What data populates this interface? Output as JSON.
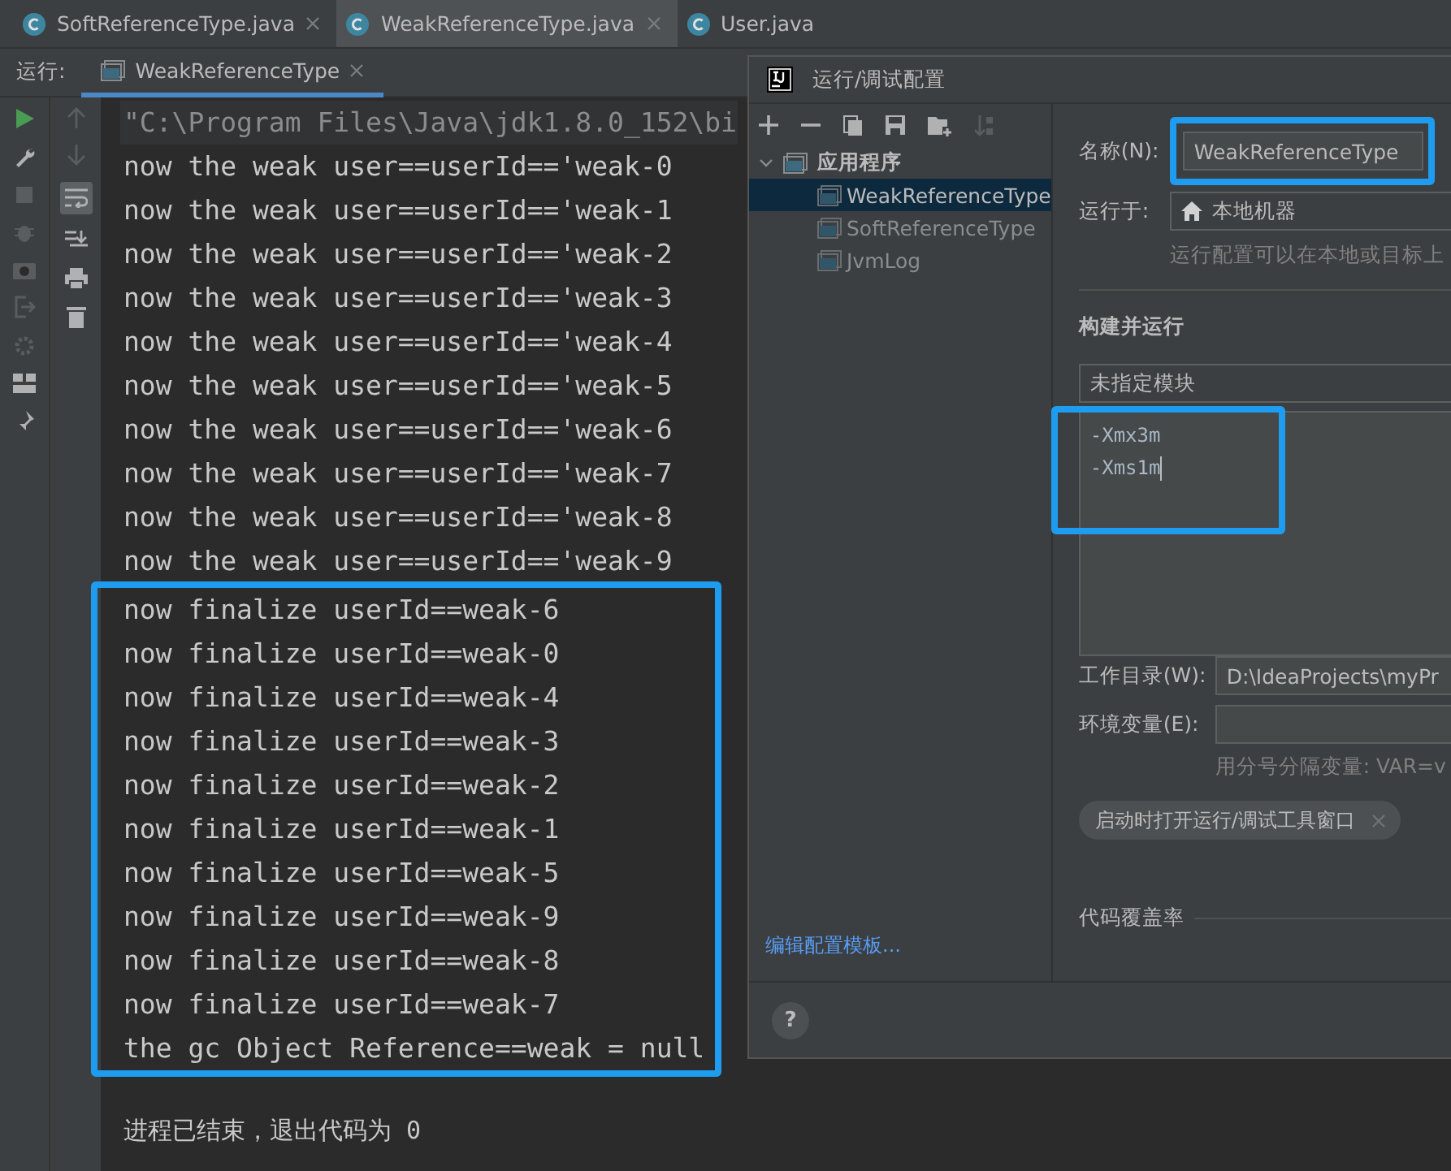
{
  "editor_tabs": [
    {
      "label": "SoftReferenceType.java",
      "selected": false
    },
    {
      "label": "WeakReferenceType.java",
      "selected": true
    },
    {
      "label": "User.java",
      "selected": false
    }
  ],
  "run_panel": {
    "label": "运行:",
    "tab": "WeakReferenceType"
  },
  "console_toolbar": {
    "soft_wrap": true
  },
  "console": {
    "command": "\"C:\\Program Files\\Java\\jdk1.8.0_152\\bi",
    "groups": [
      {
        "highlighted": false,
        "lines": [
          "now the weak user==userId=='weak-0",
          "now the weak user==userId=='weak-1",
          "now the weak user==userId=='weak-2",
          "now the weak user==userId=='weak-3",
          "now the weak user==userId=='weak-4",
          "now the weak user==userId=='weak-5",
          "now the weak user==userId=='weak-6",
          "now the weak user==userId=='weak-7",
          "now the weak user==userId=='weak-8",
          "now the weak user==userId=='weak-9"
        ]
      },
      {
        "highlighted": true,
        "lines": [
          "now finalize userId==weak-6",
          "now finalize userId==weak-0",
          "now finalize userId==weak-4",
          "now finalize userId==weak-3",
          "now finalize userId==weak-2",
          "now finalize userId==weak-1",
          "now finalize userId==weak-5",
          "now finalize userId==weak-9",
          "now finalize userId==weak-8",
          "now finalize userId==weak-7",
          "the gc Object Reference==weak = null"
        ]
      }
    ],
    "exit_message": "进程已结束，退出代码为 0"
  },
  "dialog": {
    "title": "运行/调试配置",
    "tree": [
      {
        "label": "应用程序",
        "expanded": true,
        "children": [
          {
            "label": "WeakReferenceType",
            "selected": true
          },
          {
            "label": "SoftReferenceType",
            "selected": false
          },
          {
            "label": "JvmLog",
            "selected": false
          }
        ]
      }
    ],
    "templates_link": "编辑配置模板...",
    "form": {
      "name_label": "名称(N):",
      "name_value": "WeakReferenceType",
      "name_highlighted": true,
      "run_on_label": "运行于:",
      "run_on_value": "本地机器",
      "run_on_hint": "运行配置可以在本地或目标上",
      "build_heading": "构建并运行",
      "module": "未指定模块",
      "vm_options": [
        "-Xmx3m",
        "-Xms1m"
      ],
      "vm_highlighted": true,
      "workdir_label": "工作目录(W):",
      "workdir_value": "D:\\IdeaProjects\\myPr",
      "env_label": "环境变量(E):",
      "env_hint": "用分号分隔变量: VAR=v",
      "chip": "启动时打开运行/调试工具窗口",
      "coverage_heading": "代码覆盖率"
    },
    "help": "?"
  }
}
